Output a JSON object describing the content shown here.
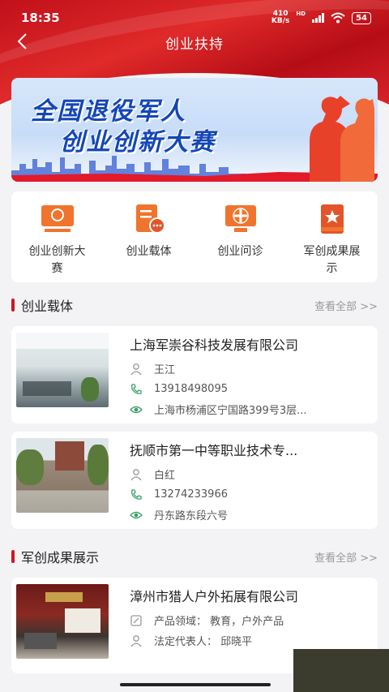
{
  "status_bar": {
    "time": "18:35",
    "net_speed": "410\nKB/s",
    "net_type": "HD",
    "battery": "54"
  },
  "nav": {
    "title": "创业扶持"
  },
  "banner": {
    "line1": "全国退役军人",
    "line2": "创业创新大赛"
  },
  "menu": [
    {
      "label": "创业创新大赛",
      "icon": "award-screen-icon"
    },
    {
      "label": "创业载体",
      "icon": "document-chat-icon"
    },
    {
      "label": "创业问诊",
      "icon": "medical-consult-icon"
    },
    {
      "label": "军创成果展示",
      "icon": "star-book-icon"
    }
  ],
  "section1": {
    "title": "创业载体",
    "view_all": "查看全部 >>"
  },
  "carriers": [
    {
      "name": "上海军崇谷科技发展有限公司",
      "contact": "王江",
      "phone": "13918498095",
      "address": "上海市杨浦区宁国路399号3层..."
    },
    {
      "name": "抚顺市第一中等职业技术专...",
      "contact": "白红",
      "phone": "13274233966",
      "address": "丹东路东段六号"
    }
  ],
  "section2": {
    "title": "军创成果展示",
    "view_all": "查看全部 >>"
  },
  "achievements": [
    {
      "name": "漳州市猎人户外拓展有限公司",
      "field": "产品领域：  教育，户外产品",
      "legal_rep": "法定代表人：  邱晓平"
    }
  ],
  "colors": {
    "brand_red": "#d0161f",
    "banner_blue": "#1446b8"
  }
}
